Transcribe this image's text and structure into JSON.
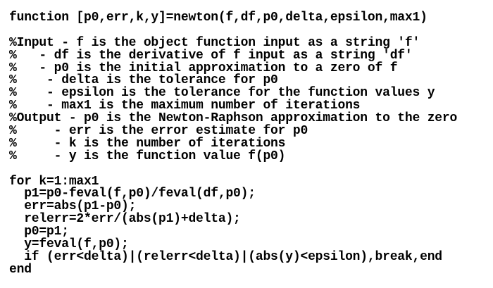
{
  "document": {
    "lines": [
      "function [p0,err,k,y]=newton(f,df,p0,delta,epsilon,max1)",
      "",
      "%Input - f is the object function input as a string 'f'",
      "%   - df is the derivative of f input as a string 'df'",
      "%   - p0 is the initial approximation to a zero of f",
      "%    - delta is the tolerance for p0",
      "%    - epsilon is the tolerance for the function values y",
      "%    - max1 is the maximum number of iterations",
      "%Output - p0 is the Newton-Raphson approximation to the zero",
      "%     - err is the error estimate for p0",
      "%     - k is the number of iterations",
      "%     - y is the function value f(p0)",
      "",
      "for k=1:max1",
      "  p1=p0-feval(f,p0)/feval(df,p0);",
      "  err=abs(p1-p0);",
      "  relerr=2*err/(abs(p1)+delta);",
      "  p0=p1;",
      "  y=feval(f,p0);",
      "  if (err<delta)|(relerr<delta)|(abs(y)<epsilon),break,end",
      "end"
    ]
  }
}
